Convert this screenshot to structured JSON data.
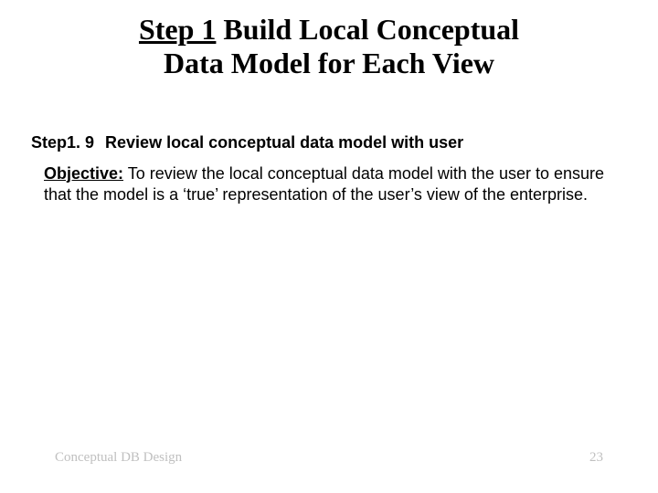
{
  "title": {
    "step_prefix": "Step 1",
    "rest_line1": " Build Local Conceptual",
    "line2": "Data Model for Each View"
  },
  "body": {
    "step_number": "Step1. 9",
    "step_title": "Review local conceptual data model with user",
    "objective_label": "Objective:",
    "objective_text": " To review the local conceptual data model with the user to ensure that the model is a ‘true’ representation of the user’s view of the enterprise."
  },
  "footer": {
    "left": "Conceptual DB Design",
    "page_number": "23"
  }
}
